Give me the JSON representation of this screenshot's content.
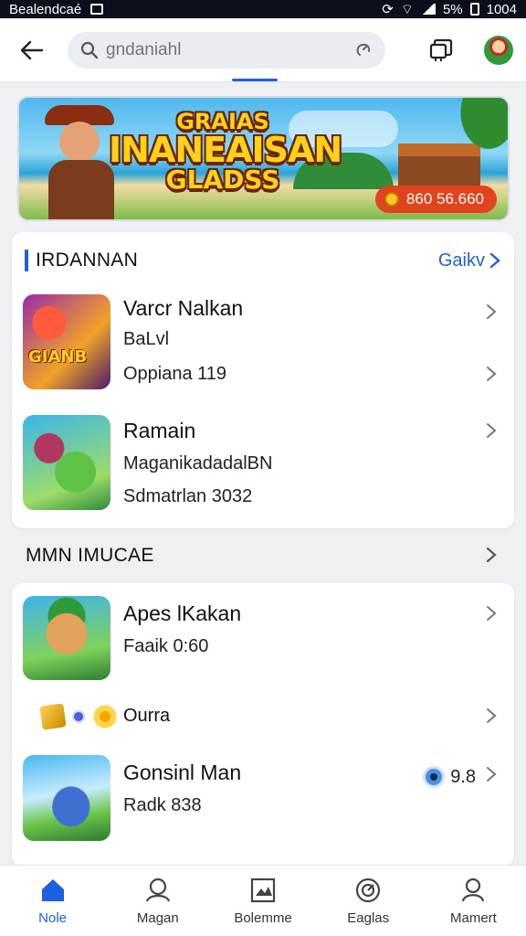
{
  "status_bar": {
    "left_text": "Bealendcaé",
    "right_text": "5%",
    "time": "1004"
  },
  "search": {
    "placeholder": "ɡndaniahl"
  },
  "banner": {
    "title_lines": [
      "GRAIAS",
      "INANEAISAN",
      "GLADSS"
    ],
    "pill_text": "860 56.660",
    "pill_color": "#e3431c"
  },
  "section1": {
    "title": "IRDANNAN",
    "link": "Gaikv",
    "items": [
      {
        "title": "Varcr Nalkan",
        "line2": "BaLvl",
        "line3": "Oppiana 119",
        "thumb_text": "GIANB"
      },
      {
        "title": "Ramain",
        "line2": "MaganikadadalBN",
        "line3": "Sdmatrlan 3032"
      }
    ]
  },
  "section2": {
    "title": "MMN IMUCAE",
    "items": [
      {
        "title": "Apes lKakan",
        "line2": "Faaik 0:60"
      },
      {
        "title": "Ourra"
      },
      {
        "title": "Gonsinl Man",
        "line2": "Radk 838",
        "rating": "9.8"
      }
    ]
  },
  "nav": [
    {
      "label": "Nole",
      "icon": "home-icon",
      "active": true
    },
    {
      "label": "Magan",
      "icon": "person-outline-icon",
      "active": false
    },
    {
      "label": "Bolemme",
      "icon": "picture-frame-icon",
      "active": false
    },
    {
      "label": "Eaglas",
      "icon": "target-icon",
      "active": false
    },
    {
      "label": "Mamert",
      "icon": "profile-icon",
      "active": false
    }
  ],
  "colors": {
    "accent": "#1c62e0",
    "background": "#eef0f4"
  }
}
